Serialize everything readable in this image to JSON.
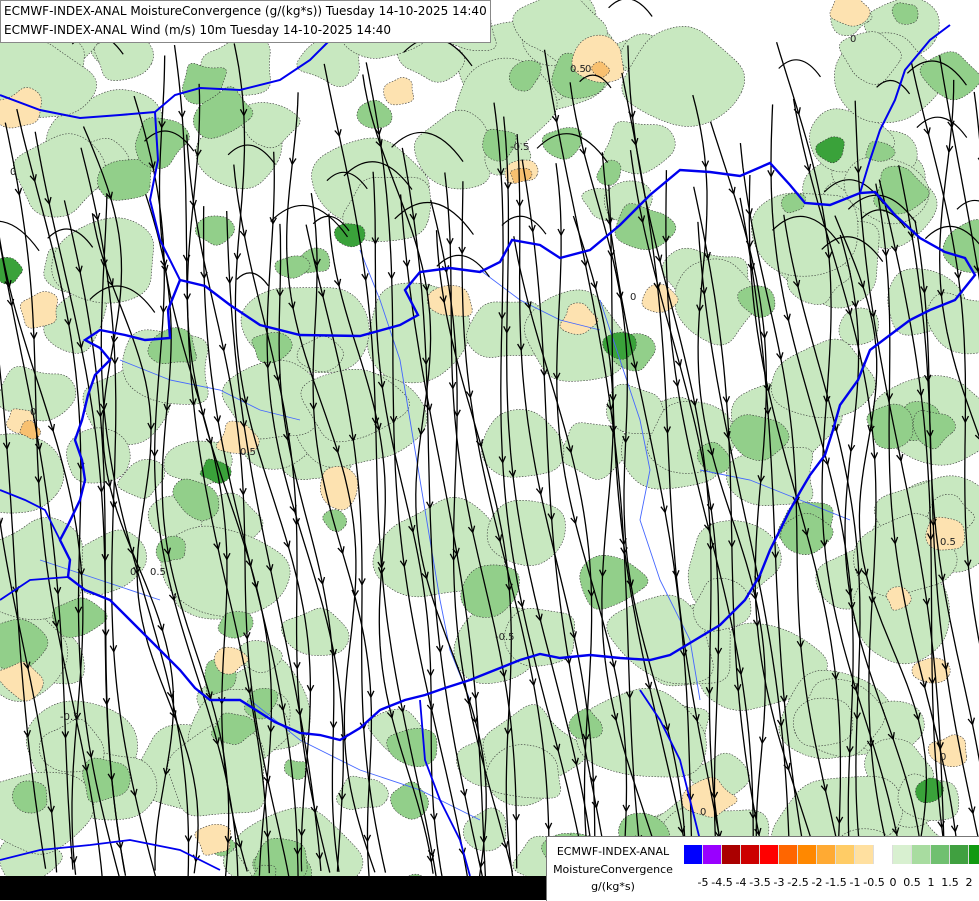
{
  "titles": {
    "line1": "ECMWF-INDEX-ANAL MoistureConvergence (g/(kg*s)) Tuesday 14-10-2025 14:40",
    "line2": "ECMWF-INDEX-ANAL Wind (m/s) 10m Tuesday 14-10-2025 14:40"
  },
  "legend": {
    "model": "ECMWF-INDEX-ANAL",
    "parameter": "MoistureConvergence",
    "unit": "g/(kg*s)",
    "colors": [
      "#0000ff",
      "#9900ff",
      "#aa0000",
      "#cc0000",
      "#ff0000",
      "#ff6600",
      "#ff8800",
      "#ffaa33",
      "#ffcc66",
      "#ffe0a0",
      "#ffffff",
      "#d8f0d0",
      "#a8dca0",
      "#70c070",
      "#40a040",
      "#119911"
    ],
    "tick_labels": [
      "-5",
      "-4.5",
      "-4",
      "-3.5",
      "-3",
      "-2.5",
      "-2",
      "-1.5",
      "-1",
      "-0.5",
      "0",
      "0.5",
      "1",
      "1.5",
      "2"
    ]
  },
  "contour_labels": [
    "0",
    "0.5",
    "-0.5",
    "0",
    "0",
    "0.5",
    "0",
    "-0.5",
    "0.5",
    "0",
    "0",
    "0",
    "-0.5",
    "0.5",
    "0"
  ],
  "map_colors": {
    "background": "#ffffff",
    "convergence_light": "#c8e8c0",
    "convergence_mid": "#92cf8a",
    "convergence_strong": "#3aa23a",
    "divergence_light": "#fde2b0",
    "divergence_mid": "#f8c070",
    "divergence_strong": "#f0a020",
    "border": "#0000ee",
    "river": "#4466ff",
    "streamline": "#000000"
  }
}
